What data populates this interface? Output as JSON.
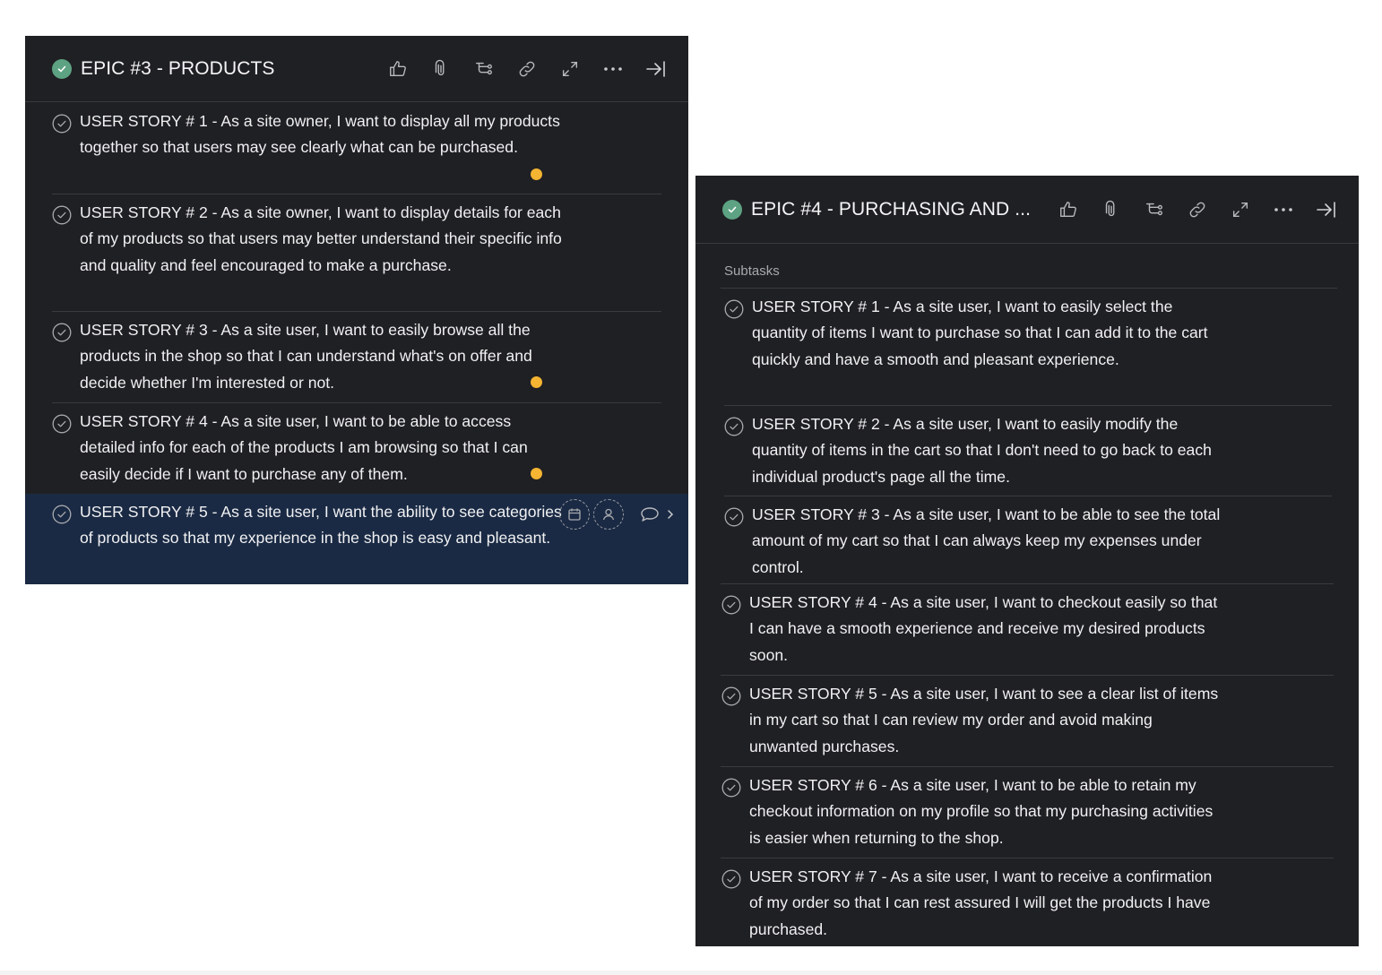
{
  "colors": {
    "panel_bg": "#1f2023",
    "selected_bg": "#1a2a44",
    "done_green": "#5da283",
    "dot_orange": "#f5b432",
    "divider": "#3a3b3e"
  },
  "icons": [
    "thumbs-up-icon",
    "paperclip-icon",
    "subtask-icon",
    "link-icon",
    "expand-icon",
    "more-icon",
    "close-panel-icon",
    "check-circle-icon",
    "calendar-icon",
    "assignee-icon",
    "comment-icon",
    "chevron-right-icon"
  ],
  "epic3": {
    "title": "EPIC #3 - PRODUCTS",
    "stories": [
      {
        "text": "USER STORY # 1 - As a site owner, I want to display all my products together so that users may see clearly what can be purchased.",
        "has_dot": true
      },
      {
        "text": "USER STORY # 2 - As a site owner, I want to display details for each of my products so that users may better understand their specific info and quality and feel encouraged to make a purchase.",
        "has_dot": false
      },
      {
        "text": "USER STORY # 3 - As a site user, I want to easily browse all the products in the shop so that I can understand what's on offer and decide whether I'm interested or not.",
        "has_dot": true
      },
      {
        "text": "USER STORY # 4 - As a site user, I want to be able to access detailed info for each of the products I am browsing so that I can easily decide if I want to purchase any of them.",
        "has_dot": true
      },
      {
        "text": "USER STORY # 5 - As a site user, I want the ability to see categories of products so that my experience in the shop is easy and pleasant.",
        "has_dot": false,
        "selected": true
      }
    ]
  },
  "epic4": {
    "title": "EPIC #4 - PURCHASING AND ...",
    "subtasks_label": "Subtasks",
    "stories": [
      {
        "text": "USER STORY # 1 - As a site user, I want to easily select the quantity of items I want to purchase so that I can add it to the cart quickly and have a smooth and pleasant experience."
      },
      {
        "text": "USER STORY # 2 - As a site user, I want to easily modify the quantity of items in the cart so that I don't need to go back to each individual product's page all the time."
      },
      {
        "text": "USER STORY # 3 - As a site user, I want to be able to see the total amount of my cart so that I can always keep my expenses under control."
      },
      {
        "text": "USER STORY # 4 - As a site user, I want to checkout easily so that I can have a smooth experience and receive my desired products soon."
      },
      {
        "text": "USER STORY # 5 - As a site user, I want to see a clear list of items in my cart so that I can review my order and avoid making unwanted purchases."
      },
      {
        "text": "USER STORY # 6 - As a site user, I want to be able to retain my checkout information on my profile so that my purchasing activities is easier when returning to the shop."
      },
      {
        "text": "USER STORY # 7 - As a site user, I want to receive a confirmation of my order so that I can rest assured I will get the products I have purchased."
      }
    ]
  }
}
